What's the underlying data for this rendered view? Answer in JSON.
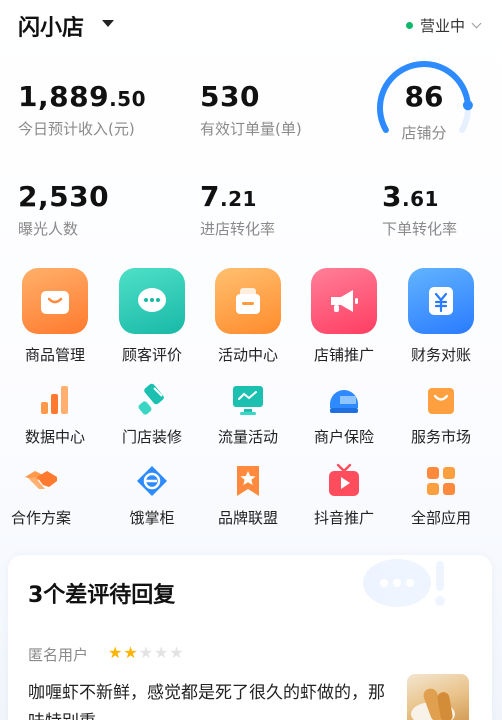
{
  "header": {
    "store_name": "闪小店",
    "status": "营业中"
  },
  "stats_top": [
    {
      "int": "1,889",
      "dec": ".50",
      "label": "今日预计收入(元)"
    },
    {
      "int": "530",
      "dec": "",
      "label": "有效订单量(单)"
    }
  ],
  "score": {
    "value": "86",
    "label": "店铺分",
    "progress_fraction": 0.86
  },
  "stats_bottom": [
    {
      "int": "2,530",
      "dec": "",
      "label": "曝光人数"
    },
    {
      "int": "7",
      "dec": ".21",
      "label": "进店转化率"
    },
    {
      "int": "3",
      "dec": ".61",
      "label": "下单转化率"
    }
  ],
  "primary_grid": [
    {
      "label": "商品管理",
      "icon": "shopping-bag-icon",
      "color": "#ff8a3d"
    },
    {
      "label": "顾客评价",
      "icon": "chat-bubble-icon",
      "color": "#22c7b3"
    },
    {
      "label": "活动中心",
      "icon": "gift-box-icon",
      "color": "#ff9a3c"
    },
    {
      "label": "店铺推广",
      "icon": "megaphone-icon",
      "color": "#ff5370"
    },
    {
      "label": "财务对账",
      "icon": "yuan-ledger-icon",
      "color": "#2e8bff"
    }
  ],
  "secondary_grid": [
    {
      "label": "数据中心",
      "icon": "bar-chart-icon",
      "color": "#ff8a3d"
    },
    {
      "label": "门店装修",
      "icon": "paint-brush-icon",
      "color": "#1cc0b0"
    },
    {
      "label": "流量活动",
      "icon": "monitor-icon",
      "color": "#1cc0b0"
    },
    {
      "label": "商户保险",
      "icon": "helmet-icon",
      "color": "#2e8bff"
    },
    {
      "label": "服务市场",
      "icon": "shopping-bag-icon",
      "color": "#ff9a3c"
    },
    {
      "label": "合作方案",
      "icon": "handshake-icon",
      "color": "#ff8a3d"
    },
    {
      "label": "饿掌柜",
      "icon": "e-diamond-icon",
      "color": "#2e8bff"
    },
    {
      "label": "品牌联盟",
      "icon": "star-bookmark-icon",
      "color": "#ff8a3d"
    },
    {
      "label": "抖音推广",
      "icon": "tv-play-icon",
      "color": "#ff4d5e"
    },
    {
      "label": "全部应用",
      "icon": "all-apps-icon",
      "color": "#ff8a3d"
    }
  ],
  "review_card": {
    "title": "3个差评待回复",
    "user": "匿名用户",
    "rating": 2,
    "rating_max": 5,
    "text": "咖喱虾不新鲜，感觉都是死了很久的虾做的，那味特别重"
  },
  "colors": {
    "accent_green": "#12b76a",
    "star_active": "#ffb400",
    "star_inactive": "#e3e3e3",
    "gauge_blue": "#2e8bff"
  }
}
